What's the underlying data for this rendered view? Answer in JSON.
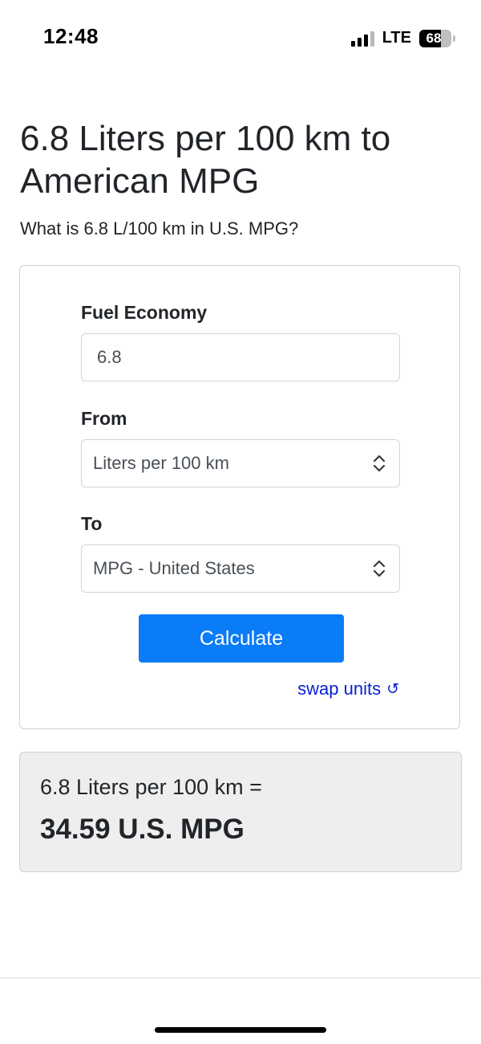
{
  "status_bar": {
    "time": "12:48",
    "network": "LTE",
    "battery_level": "68",
    "battery_percent": 68,
    "signal_bars_active": 3,
    "signal_bars_total": 4
  },
  "page": {
    "title": "6.8 Liters per 100 km to American MPG",
    "subtitle": "What is 6.8 L/100 km in U.S. MPG?"
  },
  "converter": {
    "fuel_economy_label": "Fuel Economy",
    "fuel_economy_value": "6.8",
    "from_label": "From",
    "from_selected": "Liters per 100 km",
    "to_label": "To",
    "to_selected": "MPG - United States",
    "calculate_label": "Calculate",
    "swap_label": "swap units",
    "swap_icon": "↺"
  },
  "result": {
    "equation": "6.8 Liters per 100 km =",
    "value": "34.59 U.S. MPG"
  },
  "colors": {
    "accent": "#0a7cf7",
    "link": "#0a1fd1",
    "result_background": "#eeeeee"
  }
}
